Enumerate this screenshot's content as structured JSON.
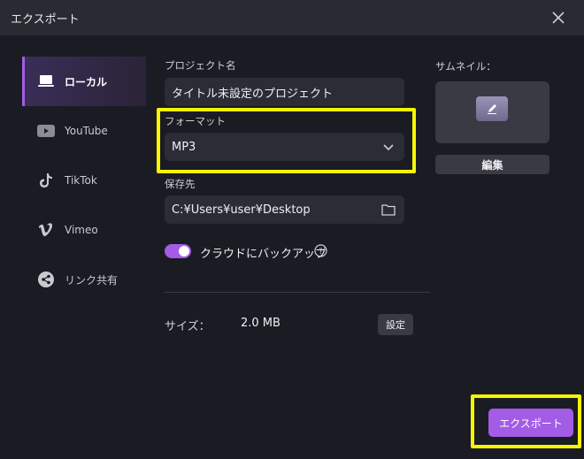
{
  "window": {
    "title": "エクスポート",
    "close_icon": "close-icon"
  },
  "sidebar": {
    "items": [
      {
        "label": "ローカル",
        "icon": "computer-icon",
        "active": true
      },
      {
        "label": "YouTube",
        "icon": "youtube-icon",
        "active": false
      },
      {
        "label": "TikTok",
        "icon": "tiktok-icon",
        "active": false
      },
      {
        "label": "Vimeo",
        "icon": "vimeo-icon",
        "active": false
      },
      {
        "label": "リンク共有",
        "icon": "share-icon",
        "active": false
      }
    ]
  },
  "form": {
    "project_name_label": "プロジェクト名",
    "project_name_value": "タイトル未設定のプロジェクト",
    "format_label": "フォーマット",
    "format_value": "MP3",
    "save_to_label": "保存先",
    "save_to_value": "C:¥Users¥user¥Desktop",
    "cloud_backup_label": "クラウドにバックアップ",
    "cloud_backup_enabled": true,
    "size_label": "サイズ：",
    "size_value": "2.0 MB",
    "settings_label": "設定"
  },
  "thumbnail": {
    "label": "サムネイル：",
    "edit_label": "編集"
  },
  "actions": {
    "export_label": "エクスポート"
  },
  "colors": {
    "accent": "#a35ce6",
    "highlight": "#f5f500",
    "background": "#1b1b24"
  }
}
